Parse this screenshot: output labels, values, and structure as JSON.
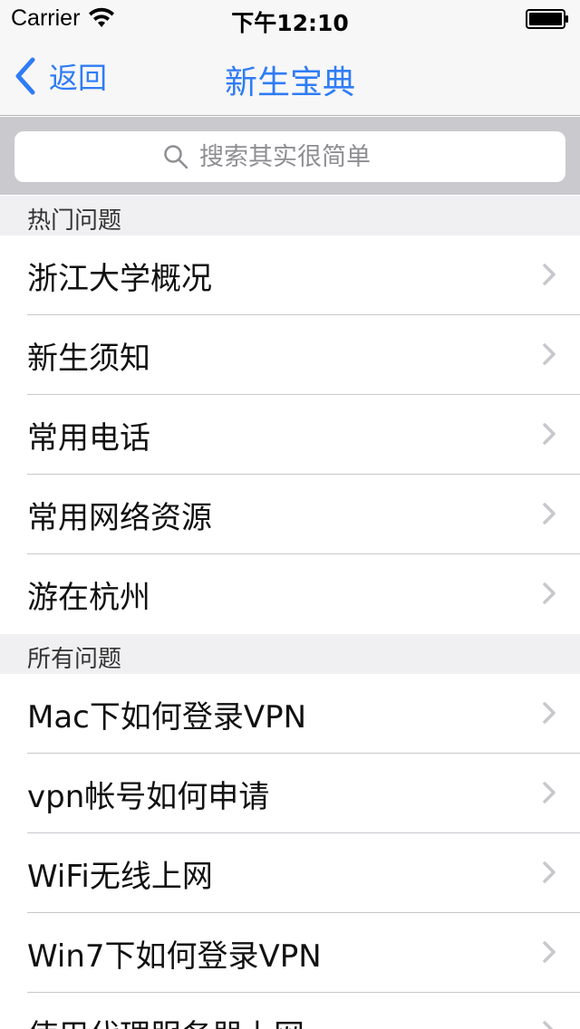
{
  "status_bar": {
    "carrier": "Carrier",
    "time": "下午12:10",
    "icons": [
      "wifi-icon",
      "battery-icon"
    ]
  },
  "nav": {
    "back_label": "返回",
    "title": "新生宝典",
    "accent_color": "#2f7cf6"
  },
  "search": {
    "placeholder": "搜索其实很简单"
  },
  "sections": [
    {
      "header": "热门问题",
      "items": [
        "浙江大学概况",
        "新生须知",
        "常用电话",
        "常用网络资源",
        "游在杭州"
      ]
    },
    {
      "header": "所有问题",
      "items": [
        "Mac下如何登录VPN",
        "vpn帐号如何申请",
        "WiFi无线上网",
        "Win7下如何登录VPN",
        "使用代理服务器上网"
      ]
    }
  ]
}
